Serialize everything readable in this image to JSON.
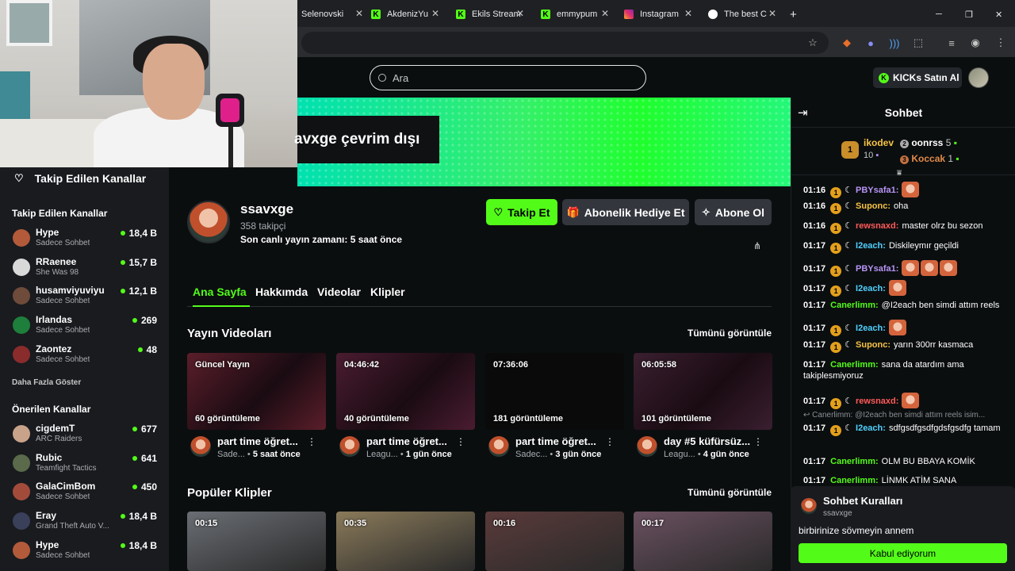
{
  "browser": {
    "tabs": [
      {
        "label": "Selenovski",
        "color": "#e8eaed",
        "icon": "blank"
      },
      {
        "label": "AkdenizYu",
        "color": "#53fc18",
        "icon": "kick-icon"
      },
      {
        "label": "Ekils Stream",
        "color": "#53fc18",
        "icon": "kick-icon"
      },
      {
        "label": "emmypum",
        "color": "#53fc18",
        "icon": "kick-icon"
      },
      {
        "label": "Instagram",
        "color": "#e1306c",
        "icon": "instagram-icon"
      },
      {
        "label": "The best C",
        "color": "#ffffff",
        "icon": "generic-icon"
      }
    ],
    "new_tab": "+",
    "min": "─",
    "max": "❐",
    "close": "✕"
  },
  "topbar": {
    "search_placeholder": "Ara",
    "kicks_label": "KICKs Satın Al"
  },
  "sidebar": {
    "header": "Takip Edilen Kanallar",
    "followed_title": "Takip Edilen Kanallar",
    "followed": [
      {
        "name": "Hype",
        "sub": "Sadece Sohbet",
        "viewers": "18,4 B",
        "color": "#b35a3a"
      },
      {
        "name": "RRaenee",
        "sub": "She Was 98",
        "viewers": "15,7 B",
        "color": "#d9d9d9"
      },
      {
        "name": "husamviyuviyu",
        "sub": "Sadece Sohbet",
        "viewers": "12,1 B",
        "color": "#6e4b3a"
      },
      {
        "name": "Irlandas",
        "sub": "Sadece Sohbet",
        "viewers": "269",
        "color": "#1e7f3c"
      },
      {
        "name": "Zaontez",
        "sub": "Sadece Sohbet",
        "viewers": "48",
        "color": "#8a2c2c"
      }
    ],
    "show_more": "Daha Fazla Göster",
    "recommended_title": "Önerilen Kanallar",
    "recommended": [
      {
        "name": "cigdemT",
        "sub": "ARC Raiders",
        "viewers": "677",
        "color": "#c9a28a"
      },
      {
        "name": "Rubic",
        "sub": "Teamfight Tactics",
        "viewers": "641",
        "color": "#5a6a4a"
      },
      {
        "name": "GalaCimBom",
        "sub": "Sadece Sohbet",
        "viewers": "450",
        "color": "#a34b3b"
      },
      {
        "name": "Eray",
        "sub": "Grand Theft Auto V...",
        "viewers": "18,4 B",
        "color": "#3a3f5a"
      },
      {
        "name": "Hype",
        "sub": "Sadece Sohbet",
        "viewers": "18,4 B",
        "color": "#b35a3a"
      }
    ]
  },
  "banner": {
    "offline_text": "avxge çevrim dışı"
  },
  "channel": {
    "name": "ssavxge",
    "followers": "358 takipçi",
    "last_live": "Son canlı yayın zamanı: 5 saat önce",
    "follow_label": "Takip Et",
    "gift_label": "Abonelik Hediye Et",
    "subscribe_label": "Abone Ol"
  },
  "tabs": [
    {
      "label": "Ana Sayfa",
      "active": true
    },
    {
      "label": "Hakkımda",
      "active": false
    },
    {
      "label": "Videolar",
      "active": false
    },
    {
      "label": "Klipler",
      "active": false
    }
  ],
  "videos": {
    "title": "Yayın Videoları",
    "see_all": "Tümünü görüntüle",
    "items": [
      {
        "badge": "Güncel Yayın",
        "views": "60 görüntüleme",
        "title": "part time öğret...",
        "category": "Sade...",
        "ago": "5 saat önce",
        "bg": "#5a1e2a"
      },
      {
        "badge": "04:46:42",
        "views": "40 görüntüleme",
        "title": "part time öğret...",
        "category": "Leagu...",
        "ago": "1 gün önce",
        "bg": "#4a1c30"
      },
      {
        "badge": "07:36:06",
        "views": "181 görüntüleme",
        "title": "part time öğret...",
        "category": "Sadec...",
        "ago": "3 gün önce",
        "bg": "#0a0a0a"
      },
      {
        "badge": "06:05:58",
        "views": "101 görüntüleme",
        "title": "day #5 küfürsüz...",
        "category": "Leagu...",
        "ago": "4 gün önce",
        "bg": "#3a1f30"
      }
    ]
  },
  "clips": {
    "title": "Popüler Klipler",
    "see_all": "Tümünü görüntüle",
    "items": [
      {
        "duration": "00:15",
        "bg": "#6a6e74"
      },
      {
        "duration": "00:35",
        "bg": "#8a7a5a"
      },
      {
        "duration": "00:16",
        "bg": "#5a3a3a"
      },
      {
        "duration": "00:17",
        "bg": "#6a5060"
      }
    ]
  },
  "chat": {
    "title": "Sohbet",
    "leaders": [
      {
        "name": "ikodev",
        "count": "10",
        "rank": "1"
      },
      {
        "name": "oonrss",
        "count": "5",
        "rank": "2"
      },
      {
        "name": "Koccak",
        "count": "1",
        "rank": "3"
      }
    ],
    "messages": [
      {
        "time": "01:16",
        "user": "PBYsafa1:",
        "color": "#b794f6",
        "text": "",
        "emotes": 1,
        "badge": "1"
      },
      {
        "time": "01:16",
        "user": "Suponc:",
        "color": "#f6c344",
        "text": "oha",
        "emotes": 0,
        "badge": "1"
      },
      {
        "time": "01:16",
        "user": "rewsnaxd:",
        "color": "#ff5a5a",
        "text": "master olrz bu sezon",
        "emotes": 0,
        "badge": "1"
      },
      {
        "time": "01:17",
        "user": "I2each:",
        "color": "#4fd1ff",
        "text": "Diskileymır geçildi",
        "emotes": 0,
        "badge": "1"
      },
      {
        "time": "01:17",
        "user": "PBYsafa1:",
        "color": "#b794f6",
        "text": "",
        "emotes": 3,
        "badge": "1"
      },
      {
        "time": "01:17",
        "user": "I2each:",
        "color": "#4fd1ff",
        "text": "",
        "emotes": 1,
        "badge": "1"
      },
      {
        "time": "01:17",
        "user": "Canerlimm:",
        "color": "#53fc18",
        "text": "@I2each ben simdi attım reels",
        "emotes": 0,
        "badge": ""
      },
      {
        "time": "01:17",
        "user": "I2each:",
        "color": "#4fd1ff",
        "text": "",
        "emotes": 1,
        "badge": "1"
      },
      {
        "time": "01:17",
        "user": "Suponc:",
        "color": "#f6c344",
        "text": "yarın 300rr kasmaca",
        "emotes": 0,
        "badge": "1"
      },
      {
        "time": "01:17",
        "user": "Canerlimm:",
        "color": "#53fc18",
        "text": "sana da atardım ama takiplesmiyoruz",
        "emotes": 0,
        "badge": ""
      },
      {
        "time": "01:17",
        "user": "rewsnaxd:",
        "color": "#ff5a5a",
        "text": "",
        "emotes": 1,
        "badge": "1"
      },
      {
        "time": "01:17",
        "user": "I2each:",
        "color": "#4fd1ff",
        "text": "sdfgsdfgsdfgdsfgsdfg tamam",
        "emotes": 0,
        "badge": "1"
      },
      {
        "time": "01:17",
        "user": "Canerlimm:",
        "color": "#53fc18",
        "text": "OLM BU BBAYA KOMİK",
        "emotes": 0,
        "badge": ""
      },
      {
        "time": "01:17",
        "user": "Canerlimm:",
        "color": "#53fc18",
        "text": "LİNMK ATİM SANA",
        "emotes": 0,
        "badge": ""
      }
    ],
    "reply_preview": "Canerlimm: @I2each ben simdi attım reels isim...",
    "rules_title": "Sohbet Kuralları",
    "rules_channel": "ssavxge",
    "rules_body": "birbirinize sövmeyin annem",
    "rules_accept": "Kabul ediyorum"
  },
  "colors": {
    "accent": "#53fc18",
    "bg": "#0b0e0f",
    "sidebar": "#191b1f"
  }
}
